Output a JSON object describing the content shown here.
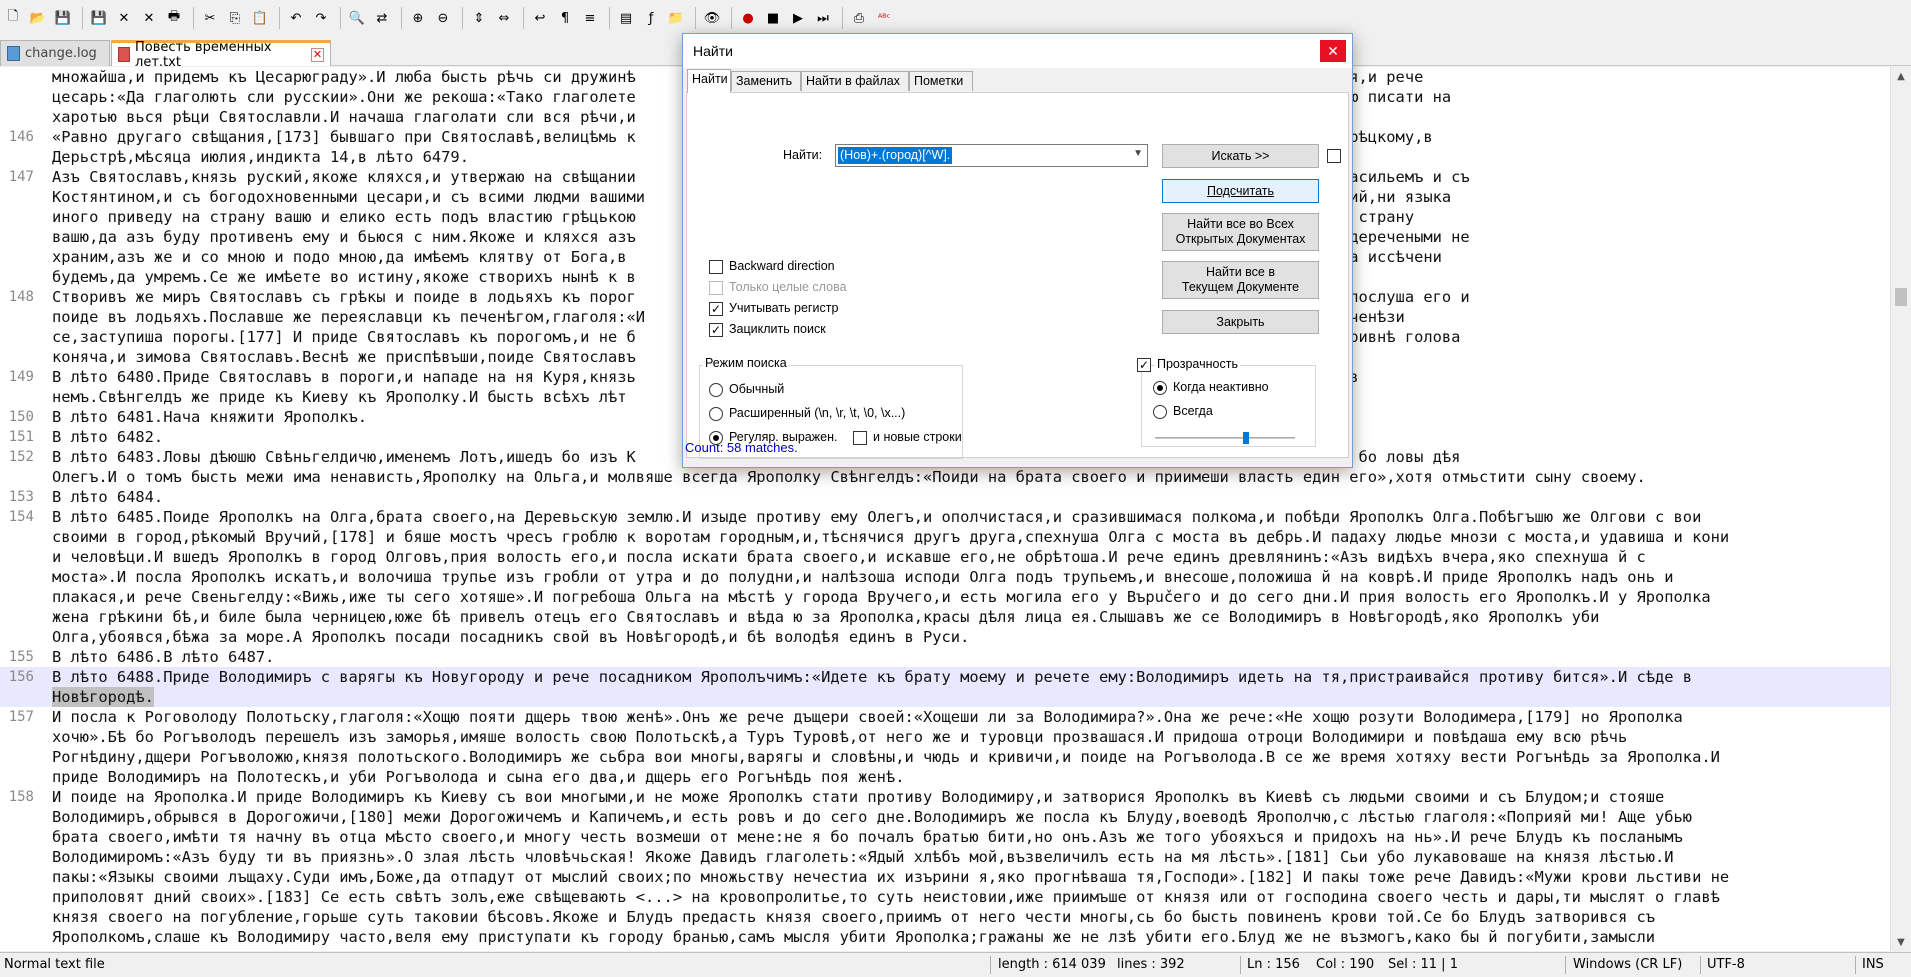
{
  "toolbar": {
    "icons": [
      "new-file-icon",
      "open-file-icon",
      "save-icon",
      "save-all-icon",
      "close-icon",
      "close-all-icon",
      "print-icon",
      "cut-icon",
      "copy-icon",
      "paste-icon",
      "undo-icon",
      "redo-icon",
      "find-icon",
      "replace-icon",
      "zoom-in-icon",
      "zoom-out-icon",
      "sync-v-icon",
      "sync-h-icon",
      "word-wrap-icon",
      "show-all-chars-icon",
      "indent-guide-icon",
      "doc-map-icon",
      "function-list-icon",
      "folder-workspace-icon",
      "monitor-icon",
      "record-macro-icon",
      "stop-macro-icon",
      "play-macro-icon",
      "run-macro-icon",
      "save-macro-icon",
      "spell-check-icon"
    ]
  },
  "tabs": [
    {
      "label": "change.log",
      "active": false
    },
    {
      "label": "Повесть временных лет.txt",
      "active": true
    }
  ],
  "editor": {
    "lines": [
      {
        "num": "",
        "text": "множайша,и придемъ къ Цесарюграду».И люба бысть рѣчь си дружинѣ                                        ша цесареви.Цесарь же наутрѣя призва я,и рече"
      },
      {
        "num": "",
        "text": "цесарь:«Да глаголють сли русскии».Они же рекоша:«Тако глаголете                                        лѣта».Цесарь же,радъ бывъ,повелѣ писцю писати на"
      },
      {
        "num": "",
        "text": "харотью вься рѣци Святославли.И начаша глаголати сли вся рѣчи,и"
      },
      {
        "num": "146",
        "text": "«Равно другаго свѣщания,[173] бывшаго при Святославѣ,велицѣмь к                                        ,нарѣцаемому Цимьскому,[174] цесарю грѣцкому,в"
      },
      {
        "num": "",
        "text": "Дерьстрѣ,мѣсяца июлия,индикта 14,в лѣто 6479."
      },
      {
        "num": "147",
        "text": "Азъ Святославъ,князь руский,якоже кляхся,и утвержаю на свѣщании                                        ликымъ цесаремь[175] грѣцькимъ и съ Васильемъ и съ"
      },
      {
        "num": "",
        "text": "Костянтином,и съ богодохновенными цесари,и съ всими людми вашими                                        помышлю на страну вашу,ни сбираю людий,ни языка"
      },
      {
        "num": "",
        "text": "иного приведу на страну вашю и елико есть подъ властию грѣцькою                                        олъгарьскъ.Да аще инъ кто помыслит на страну"
      },
      {
        "num": "",
        "text": "вашю,да азъ буду противенъ ему и бьюся с ним.Якоже и кляхся азъ                                        свѣщания.Аще ли от тѣхъ самѣхъ и преждеречеными не"
      },
      {
        "num": "",
        "text": "храним,азъ же и со мною и подо мною,да имѣемъ клятву от Бога,в                                        же золото се,[176] и своимъ оружьемь да иссѣчени"
      },
      {
        "num": "",
        "text": "будемъ,да умремъ.Се же имѣете во истину,якоже створихъ нынѣ к в"
      },
      {
        "num": "148",
        "text": "Створивъ же миръ Святославъ съ грѣкы и поиде в лодьяхъ къ порог                                        ,стоять бо печенѣзи в порозѣхъ».И не послуша его и"
      },
      {
        "num": "",
        "text": "поиде въ лодьяхъ.Пославше же переяславци къ печенѣгом,глаголя:«И                                        ъ,а с маломъ дружины».Слышавше же печенѣзи"
      },
      {
        "num": "",
        "text": "се,заступиша порогы.[177] И приде Святославъ къ порогомъ,и не б                                        шна,и бысть гладъ великъ,яко по полугривнѣ голова"
      },
      {
        "num": "",
        "text": "коняча,и зимова Святославъ.Веснѣ же приспѣвъши,поиде Святославъ"
      },
      {
        "num": "149",
        "text": "В лѣто 6480.Приде Святославъ в пороги,и нападе на ня Куря,князь                                        ѣлаша чашю,оковавше лобъ его,и пьяху в"
      },
      {
        "num": "",
        "text": "немъ.Свѣнгелдъ же приде къ Киеву къ Ярополку.И бысть всѣхъ лѣт"
      },
      {
        "num": "150",
        "text": "В лѣто 6481.Нача княжити Ярополкъ."
      },
      {
        "num": "151",
        "text": "В лѣто 6482."
      },
      {
        "num": "152",
        "text": "В лѣто 6483.Ловы дѣюшю Свѣньгелдичю,именемъ Лотъ,ишедъ бо изъ К                                        ему:«Свѣнгелдицьь».И,заѣхавъ,уби й,бѣ бо ловы дѣя"
      },
      {
        "num": "",
        "text": "Олегъ.И о томъ бысть межи има ненависть,Ярополку на Ольга,и молвяше всегда Ярополку Свѣнгелдъ:«Поиди на брата своего и приимеши власть един его»,хотя отмьстити сыну своему."
      },
      {
        "num": "153",
        "text": "В лѣто 6484."
      },
      {
        "num": "154",
        "text": "В лѣто 6485.Поиде Ярополкъ на Олга,брата своего,на Деревьскую землю.И изыде противу ему Олегъ,и ополчистася,и сразившимася полкома,и побѣди Ярополкъ Олга.Побѣгъшю же Олгови с вои"
      },
      {
        "num": "",
        "text": "своими в город,рѣкомый Вручий,[178] и бяше мостъ чресъ гроблю к воротам городным,и,тѣснячися другъ друга,спехнуша Олга с моста въ дебрь.И падаху людье мнози с моста,и удавиша и кони"
      },
      {
        "num": "",
        "text": "и человѣци.И вшедъ Ярополкъ в город Олговъ,прия волость его,и посла искати брата своего,и искавше его,не обрѣтоша.И рече единъ древлянинъ:«Азъ видѣхъ вчера,яко спехнуша й с"
      },
      {
        "num": "",
        "text": "моста».И посла Ярополкъ искатъ,и волочиша трупье изъ гробли от утра и до полудни,и налѣзоша исподи Олга подъ трупьемъ,и внесоше,положиша й на коврѣ.И приде Ярополкъ надъ онь и"
      },
      {
        "num": "",
        "text": "плакася,и рече Свеньгелду:«Вижь,иже ты сего хотяше».И погребоша Ольга на мѣстѣ у города Вручего,и есть могила его у Върučего и до сего дни.И прия волость его Ярополкъ.И у Ярополка"
      },
      {
        "num": "",
        "text": "жена грѣкини бѣ,и биле была черницею,юже бѣ привелъ отецъ его Святославъ и вѣда ю за Ярополка,красы дѣля лица ея.Слышавъ же се Володимиръ в Новѣгородѣ,яко Ярополкъ уби"
      },
      {
        "num": "",
        "text": "Олга,убоявся,бѣжа за море.А Ярополкъ посади посадникъ свой въ Новѣгородѣ,и бѣ володѣя единъ в Руси."
      },
      {
        "num": "155",
        "text": "В лѣто 6486.В лѣто 6487."
      },
      {
        "num": "156",
        "text": "В лѣто 6488.Приде Володимиръ с варягы къ Новугороду и рече посадником Ярополъчимъ:«Идете къ брату моему и речете ему:Володимиръ идеть на тя,пристраивайся противу бится».И сѣде в",
        "cur": true
      },
      {
        "num": "",
        "text": "Новѣгородѣ.",
        "cur": true,
        "sel": true
      },
      {
        "num": "157",
        "text": "И посла к Роговолоду Полотьску,глаголя:«Хощю пояти дщерь твою женѣ».Онъ же рече дъщери своей:«Хощеши ли за Володимира?».Она же рече:«Не хощю розути Володимера,[179] но Ярополка"
      },
      {
        "num": "",
        "text": "хочю».Бѣ бо Рогъволодъ перешелъ изъ заморья,имяше волость свою Полотьскѣ,а Туръ Туровѣ,от него же и туровци прозвашася.И придоша отроци Володимири и повѣдаша ему всю рѣчь"
      },
      {
        "num": "",
        "text": "Рогнѣдину,дщери Рогъволожю,князя полотьского.Володимиръ же сьбра вои многы,варягы и словѣны,и чюдь и кривичи,и поиде на Рогъволода.В се же время хотяху вести Рогънѣдь за Ярополка.И"
      },
      {
        "num": "",
        "text": "приде Володимиръ на Полотескъ,и уби Рогъволода и сына его два,и дщерь его Рогънѣдь поя женѣ."
      },
      {
        "num": "158",
        "text": "И поиде на Ярополка.И приде Володимиръ къ Киеву съ вои многыми,и не може Ярополкъ стати противу Володимиру,и затворися Ярополкъ въ Киевѣ съ людьми своими и съ Блудом;и стояше"
      },
      {
        "num": "",
        "text": "Володимиръ,обрывся в Дорогожичи,[180] межи Дорогожичемъ и Капичемъ,и есть ровъ и до сего дне.Володимиръ же посла къ Блуду,воеводѣ Ярополчю,с лѣстью глаголя:«Поприяй ми! Аще убью"
      },
      {
        "num": "",
        "text": "брата своего,имѣти тя начну въ отца мѣсто своего,и многу честь возмеши от мене:не я бо почалъ братью бити,но онъ.Азъ же того убояхъся и придохъ на нь».И рече Блудъ къ посланымъ"
      },
      {
        "num": "",
        "text": "Володимиромъ:«Азъ буду ти въ приязнь».О злая лѣсть чловѣчьская! Якоже Давидъ глаголеть:«Ядый хлѣбъ мой,възвеличилъ есть на мя лѣсть».[181] Сьи убо лукавоваше на князя лѣстью.И"
      },
      {
        "num": "",
        "text": "пакы:«Языкы своими лъщаху.Суди имъ,Боже,да отпадут от мыслий своих;по множьству нечестиа их изърини я,яко прогнѣваша тя,Господи».[182] И пакы тоже рече Давидъ:«Мужи крови льстиви не"
      },
      {
        "num": "",
        "text": "приполовят дний своих».[183] Се есть свѣтъ золъ,еже свѣщевають <...> на кровопролитье,то суть неистовии,иже приимъше от князя или от господина своего честь и дары,ти мыслят о главѣ"
      },
      {
        "num": "",
        "text": "князя своего на погубление,горьше суть таковии бѣсовъ.Якоже и Блудъ предасть князя своего,приимъ от него чести многы,сь бо бысть повиненъ крови той.Се бо Блудъ затворився съ"
      },
      {
        "num": "",
        "text": "Ярополкомъ,слаше къ Володимиру часто,веля ему приступати къ городу бранью,самъ мысля убити Ярополка;гражаны же не лзѣ убити его.Блуд же не възмогъ,како бы й погубити,замысли"
      }
    ]
  },
  "status": {
    "filetype": "Normal text file",
    "length": "length : 614 039",
    "lines": "lines : 392",
    "ln": "Ln : 156",
    "col": "Col : 190",
    "sel": "Sel : 11 | 1",
    "eol": "Windows (CR LF)",
    "encoding": "UTF-8",
    "mode": "INS"
  },
  "dialog": {
    "title": "Найти",
    "tabs": [
      "Найти",
      "Заменить",
      "Найти в файлах",
      "Пометки"
    ],
    "find_label": "Найти:",
    "find_value": "(Нов)+.(город)[^W].",
    "buttons": {
      "find_next": "Искать >>",
      "count": "Подсчитать",
      "find_all_open_1": "Найти все во Всех",
      "find_all_open_2": "Открытых Документах",
      "find_all_current_1": "Найти все в",
      "find_all_current_2": "Текущем Документе",
      "close": "Закрыть"
    },
    "options": {
      "backward": "Backward direction",
      "whole_word": "Только целые слова",
      "match_case": "Учитывать регистр",
      "wrap": "Зациклить поиск"
    },
    "search_mode": {
      "title": "Режим поиска",
      "normal": "Обычный",
      "extended": "Расширенный (\\n, \\r, \\t, \\0, \\x...)",
      "regex": "Регуляр. выражен.",
      "newline": "и новые строки"
    },
    "transparency": {
      "title": "Прозрачность",
      "on_lose_focus": "Когда неактивно",
      "always": "Всегда",
      "level": 0.65
    },
    "status_message": "Count: 58 matches."
  }
}
